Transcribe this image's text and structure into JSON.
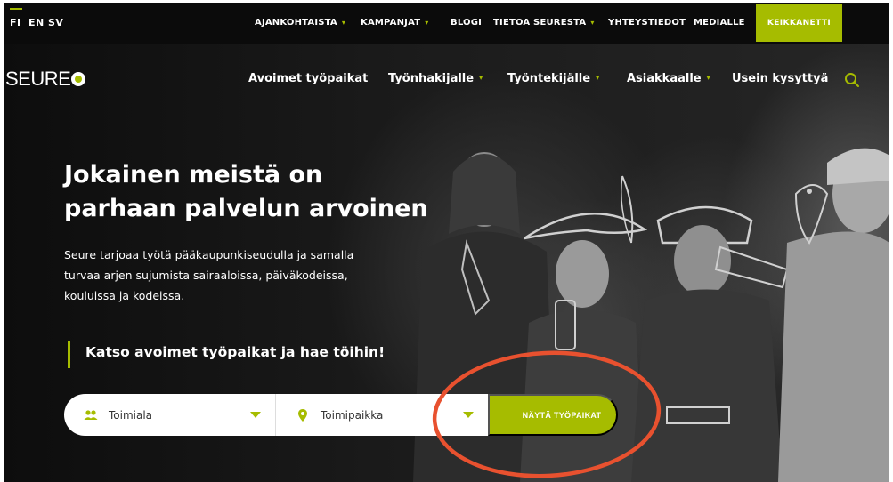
{
  "languages": [
    "FI",
    "EN",
    "SV"
  ],
  "utility_nav": {
    "items": [
      {
        "label": "AJANKOHTAISTA",
        "has_caret": true
      },
      {
        "label": "KAMPANJAT",
        "has_caret": true
      },
      {
        "label": "BLOGI",
        "has_caret": false
      },
      {
        "label": "TIETOA SEURESTA",
        "has_caret": true
      },
      {
        "label": "YHTEYSTIEDOT",
        "has_caret": false
      },
      {
        "label": "MEDIALLE",
        "has_caret": false
      }
    ],
    "keikkanetti": "KEIKKANETTI"
  },
  "logo": {
    "text": "SEURE"
  },
  "main_nav": {
    "items": [
      {
        "label": "Avoimet työpaikat",
        "has_caret": false
      },
      {
        "label": "Työnhakijalle",
        "has_caret": true
      },
      {
        "label": "Työntekijälle",
        "has_caret": true
      },
      {
        "label": "Asiakkaalle",
        "has_caret": true
      },
      {
        "label": "Usein kysyttyä",
        "has_caret": false
      }
    ]
  },
  "hero": {
    "title_line1": "Jokainen meistä on",
    "title_line2": "parhaan palvelun arvoinen",
    "text_line1": "Seure tarjoaa työtä pääkaupunkiseudulla ja samalla",
    "text_line2": "turvaa arjen sujumista sairaaloissa, päiväkodeissa,",
    "text_line3": "kouluissa ja kodeissa.",
    "cta": "Katso avoimet työpaikat ja hae töihin!"
  },
  "search": {
    "field1": "Toimiala",
    "field2": "Toimipaikka",
    "button": "NÄYTÄ TYÖPAIKAT"
  },
  "colors": {
    "accent": "#a6bc00",
    "annotation": "#e8512f",
    "background": "#151515"
  }
}
